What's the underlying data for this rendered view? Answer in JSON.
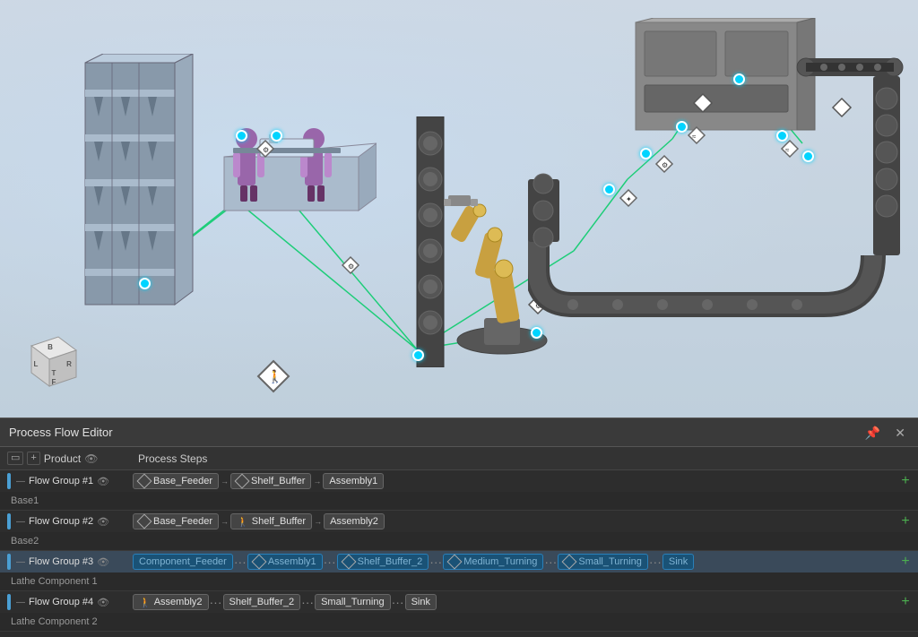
{
  "viewport": {
    "background": "#c8d8e8"
  },
  "panel": {
    "title": "Process Flow Editor",
    "pin_btn": "📌",
    "close_btn": "✕",
    "col_product_label": "Product",
    "col_steps_label": "Process Steps"
  },
  "nav_cube": {
    "faces": [
      "B",
      "L",
      "T",
      "R",
      "F"
    ]
  },
  "flow_groups": [
    {
      "id": "fg1",
      "name": "Flow Group #1",
      "sub_label": "Base1",
      "color": "#4a9fd4",
      "active": false,
      "steps": [
        {
          "label": "Base_Feeder",
          "icon": "diamond",
          "connector": "arrow"
        },
        {
          "label": "Shelf_Buffer",
          "icon": "diamond",
          "connector": "arrow"
        },
        {
          "label": "Assembly1",
          "icon": "none",
          "connector": "none"
        }
      ]
    },
    {
      "id": "fg2",
      "name": "Flow Group #2",
      "sub_label": "Base2",
      "color": "#4a9fd4",
      "active": false,
      "steps": [
        {
          "label": "Base_Feeder",
          "icon": "diamond",
          "connector": "arrow"
        },
        {
          "label": "Shelf_Buffer",
          "icon": "person",
          "connector": "arrow"
        },
        {
          "label": "Assembly2",
          "icon": "none",
          "connector": "none"
        }
      ]
    },
    {
      "id": "fg3",
      "name": "Flow Group #3",
      "sub_label": "Lathe Component 1",
      "color": "#4a9fd4",
      "active": true,
      "steps": [
        {
          "label": "Component_Feeder",
          "icon": "none",
          "connector": "dots"
        },
        {
          "label": "Assembly1",
          "icon": "diamond",
          "connector": "dots"
        },
        {
          "label": "Shelf_Buffer_2",
          "icon": "diamond",
          "connector": "dots"
        },
        {
          "label": "Medium_Turning",
          "icon": "robot",
          "connector": "dots"
        },
        {
          "label": "Small_Turning",
          "icon": "robot",
          "connector": "dots"
        },
        {
          "label": "Sink",
          "icon": "none",
          "connector": "none"
        }
      ]
    },
    {
      "id": "fg4",
      "name": "Flow Group #4",
      "sub_label": "Lathe Component 2",
      "color": "#4a9fd4",
      "active": false,
      "steps": [
        {
          "label": "Assembly2",
          "icon": "person",
          "connector": "dots"
        },
        {
          "label": "Shelf_Buffer_2",
          "icon": "none",
          "connector": "dots"
        },
        {
          "label": "Small_Turning",
          "icon": "none",
          "connector": "dots"
        },
        {
          "label": "Sink",
          "icon": "none",
          "connector": "none"
        }
      ]
    }
  ]
}
